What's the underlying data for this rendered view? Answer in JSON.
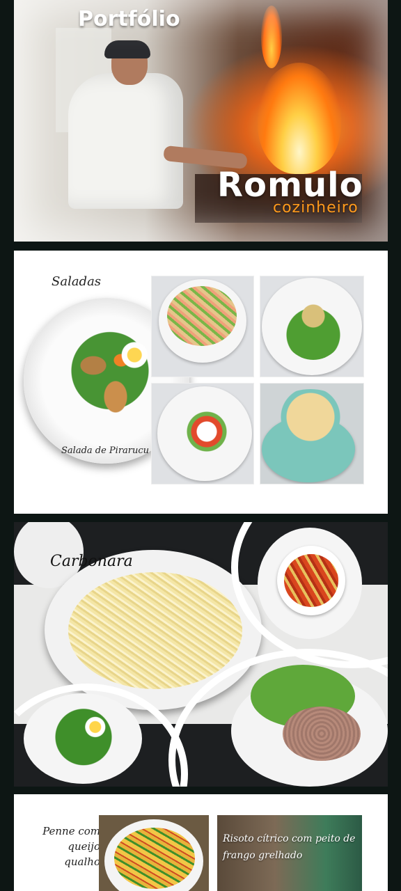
{
  "hero": {
    "title": "Portfólio",
    "name": "Romulo",
    "role": "cozinheiro"
  },
  "saladas": {
    "title": "Saladas",
    "caption": "Salada de Pirarucu"
  },
  "carbonara": {
    "title": "Carbonara"
  },
  "extras": {
    "penne_title": "Penne com queijo qualho",
    "risotto_title": "Risoto cítrico com peito de frango grelhado"
  }
}
